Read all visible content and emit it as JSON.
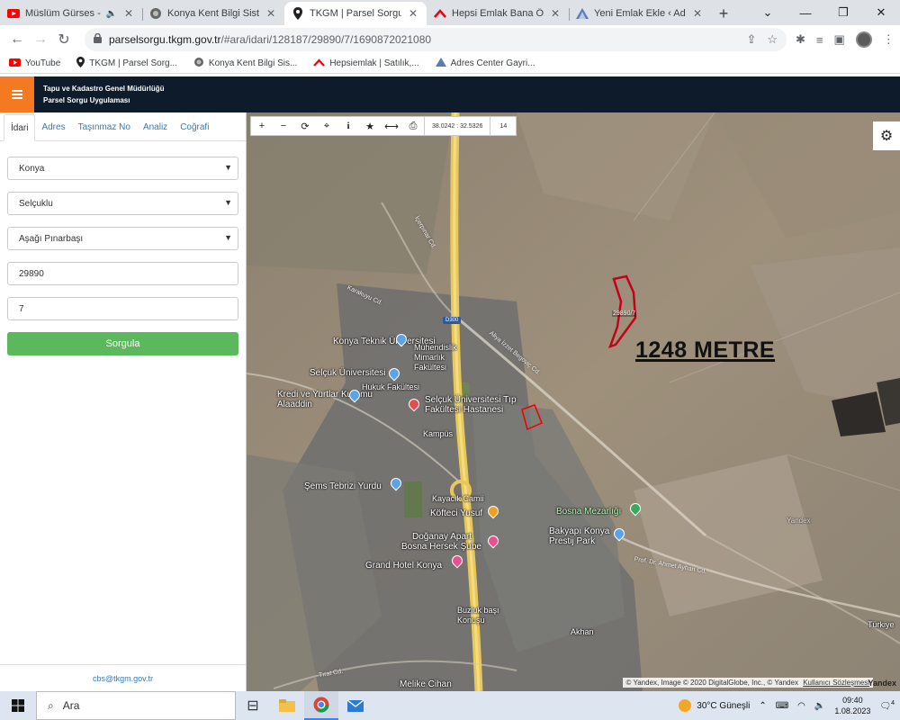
{
  "browser": {
    "tabs": [
      {
        "title": "Müslüm Gürses - Yıllar",
        "icon": "youtube-icon",
        "close": "✕"
      },
      {
        "title": "Konya Kent Bilgi Sistemi",
        "icon": "kbs-icon",
        "close": "✕"
      },
      {
        "title": "TKGM | Parsel Sorgu Uyg",
        "icon": "location-pin-icon",
        "close": "✕"
      },
      {
        "title": "Hepsi Emlak Bana Özel",
        "icon": "hepsiemlak-icon",
        "close": "✕"
      },
      {
        "title": "Yeni Emlak Ekle ‹ Adres C",
        "icon": "adres-icon",
        "close": "✕"
      }
    ],
    "active_tab": 2,
    "url_host": "parselsorgu.tkgm.gov.tr",
    "url_path": "/#ara/idari/128187/29890/7/1690872021080",
    "bookmarks": [
      {
        "label": "YouTube",
        "icon": "youtube-icon"
      },
      {
        "label": "TKGM | Parsel Sorg...",
        "icon": "location-pin-icon"
      },
      {
        "label": "Konya Kent Bilgi Sis...",
        "icon": "kbs-icon"
      },
      {
        "label": "Hepsiemlak | Satılık,...",
        "icon": "hepsiemlak-icon"
      },
      {
        "label": "Adres Center Gayri...",
        "icon": "adres-icon"
      }
    ]
  },
  "app": {
    "title_line1": "Tapu ve Kadastro Genel Müdürlüğü",
    "title_line2": "Parsel Sorgu Uygulaması",
    "accent_color": "#f47920",
    "header_bg": "#0d1b2a"
  },
  "panel": {
    "tabs": [
      "İdari",
      "Adres",
      "Taşınmaz No",
      "Analiz",
      "Coğrafi"
    ],
    "active_tab": 0,
    "il": "Konya",
    "ilce": "Selçuklu",
    "mahalle": "Aşağı Pınarbaşı",
    "ada": "29890",
    "parsel": "7",
    "submit_label": "Sorgula",
    "footer_email": "cbs@tkgm.gov.tr"
  },
  "map": {
    "coords": "38.0242 : 32.5326",
    "zoom": "14",
    "parcel_label": "29890/7",
    "annotation": "1248 METRE",
    "attribution": "© Yandex, Image © 2020 DigitalGlobe, Inc., © Yandex",
    "terms_link": "Kullanıcı Sözleşmesi",
    "logo": "Yandex",
    "road_badge": "D300",
    "places": [
      "Konya Teknik Üniversitesi",
      "Mühendislik Mimarlık Fakültesi",
      "Selçuk Üniversitesi",
      "Hukuk Fakültesi",
      "Kredi ve Yurtlar Kurumu Alaaddin",
      "Selçuk Üniversitesi Tıp Fakültesi Hastanesi",
      "Kampüs",
      "Şems Tebrizi Yurdu",
      "Kayacık Camii",
      "Köfteci Yusuf",
      "Bosna Mezarlığı",
      "Doğanay Apart",
      "Bosna Hersek Şube",
      "Bakyapı Konya Prestij Park",
      "Grand Hotel Konya",
      "Buzluk başı Konuşu",
      "Akhan",
      "Melike Cihan",
      "Türkiye",
      "Yandex"
    ],
    "roads": [
      "Aliya İzzet Begoviç Cd.",
      "Prof. Dr. Ahmet Ayhan Cd.",
      "Tırat Cd.",
      "İçerpınar Cd.",
      "Karakuyu Cd."
    ]
  },
  "taskbar": {
    "search_label": "Ara",
    "weather": "30°C  Güneşli",
    "time": "09:40",
    "date": "1.08.2023",
    "notif_count": "4"
  }
}
